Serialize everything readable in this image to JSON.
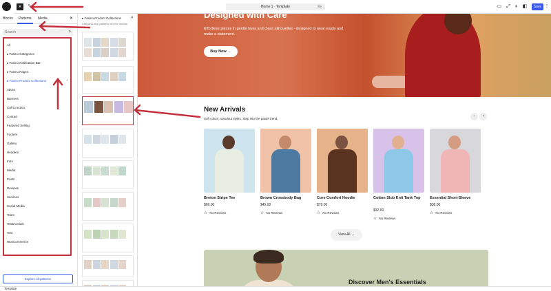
{
  "toolbar": {
    "document_title": "Home 1 · Template",
    "shortcut": "⌘K",
    "save_label": "Save",
    "inserter_glyph": "×",
    "tools_glyph": "✎"
  },
  "inserter": {
    "tabs": [
      "Blocks",
      "Patterns",
      "Media"
    ],
    "active_tab": "Patterns",
    "search_placeholder": "Search",
    "categories": [
      "All",
      "▸ Fasino Categories",
      "▸ Fasino Notification Bar",
      "▸ Fasino Pages",
      "▸ Fasino Product Collections",
      "About",
      "Banners",
      "Call to action",
      "Contact",
      "Featured Selling",
      "Footers",
      "Gallery",
      "Headers",
      "Intro",
      "Media",
      "Posts",
      "Reviews",
      "Services",
      "Social Media",
      "Team",
      "Testimonials",
      "Text",
      "WooCommerce"
    ],
    "selected_category": "▸ Fasino Product Collections",
    "explore_label": "Explore all patterns"
  },
  "patterns_panel": {
    "heading": "▸ Fasino Product Collections",
    "description": "Drag and drop patterns into the canvas."
  },
  "hero": {
    "title": "Designed with Care",
    "subtitle": "Effortless pieces in gentle hues and clean silhouettes - designed to wear easily and make a statement.",
    "button": "Buy Now →"
  },
  "new_arrivals": {
    "title": "New Arrivals",
    "subtitle": "Soft colors, standout styles. Step into the pastel trend.",
    "products": [
      {
        "name": "Breton Stripe Tee",
        "price": "$69.00",
        "reviews": "No Reviews",
        "bg": "#cde3ee",
        "top": "#e8efe2",
        "skin": "#5a3a2a"
      },
      {
        "name": "Brown Crossbody Bag",
        "price": "$45.00",
        "reviews": "No Reviews",
        "bg": "#f0c3a8",
        "top": "#4d7aa0",
        "skin": "#c48b6a"
      },
      {
        "name": "Core Comfort Hoodie",
        "price": "$79.00",
        "reviews": "No Reviews",
        "bg": "#e6b28a",
        "top": "#5a3220",
        "skin": "#7a5440"
      },
      {
        "name": "Cotton Slub Knit Tank Top",
        "price": "$32.00",
        "reviews": "No Reviews",
        "bg": "#d8c2ea",
        "top": "#8ec8e8",
        "skin": "#e0b090"
      },
      {
        "name": "Essential Short-Sleeve",
        "price": "$38.00",
        "reviews": "No Reviews",
        "bg": "#d8d8dc",
        "top": "#f0b6b6",
        "skin": "#d49c80"
      }
    ],
    "view_all": "View All →"
  },
  "banner": {
    "title": "Discover Men's Essentials"
  },
  "footer": {
    "label": "Template"
  },
  "colors": {
    "accent": "#3858e9",
    "annotation": "#c4303c"
  }
}
